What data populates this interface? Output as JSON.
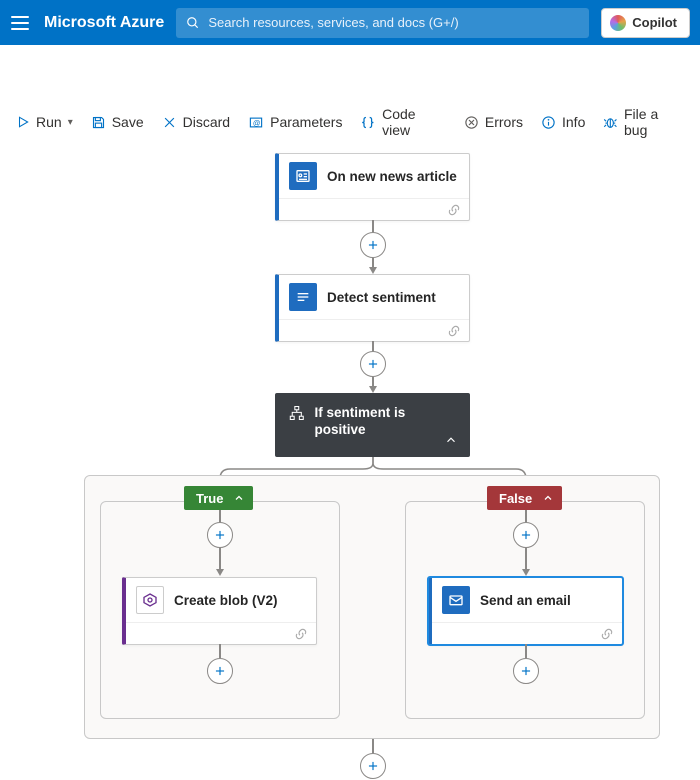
{
  "header": {
    "brand": "Microsoft Azure",
    "search_placeholder": "Search resources, services, and docs (G+/)",
    "copilot_label": "Copilot"
  },
  "toolbar": {
    "run": "Run",
    "save": "Save",
    "discard": "Discard",
    "parameters": "Parameters",
    "code_view": "Code view",
    "errors": "Errors",
    "info": "Info",
    "file_bug": "File a bug"
  },
  "workflow": {
    "trigger": {
      "title": "On new news article"
    },
    "action_detect": {
      "title": "Detect sentiment"
    },
    "condition": {
      "title": "If sentiment is positive"
    },
    "true_branch": {
      "label": "True",
      "action": {
        "title": "Create blob (V2)"
      }
    },
    "false_branch": {
      "label": "False",
      "action": {
        "title": "Send an email"
      }
    }
  }
}
